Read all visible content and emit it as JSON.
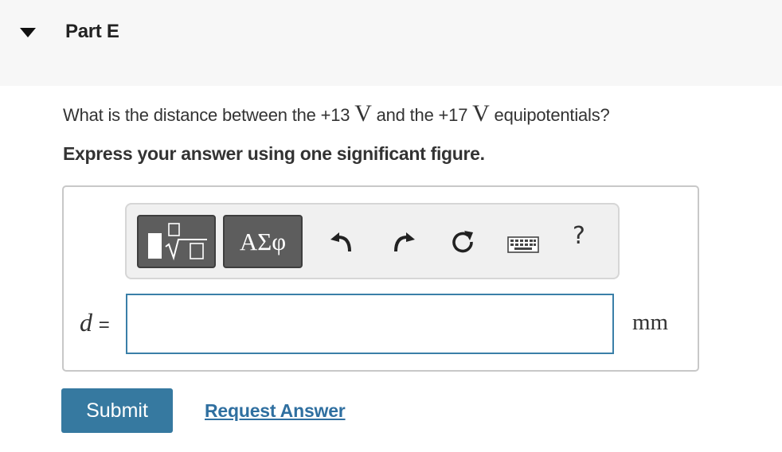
{
  "part": {
    "title": "Part E"
  },
  "question": {
    "prefix": "What is the distance between the +13 ",
    "unit_symbol_1": "V",
    "middle": " and the +17 ",
    "unit_symbol_2": "V",
    "suffix": " equipotentials?",
    "instruction": "Express your answer using one significant figure."
  },
  "toolbar": {
    "template_button_icon": "template-sqrt-icon",
    "symbols_button_label": "ΑΣφ",
    "undo_icon": "undo-icon",
    "redo_icon": "redo-icon",
    "reset_icon": "reset-icon",
    "keyboard_icon": "keyboard-icon",
    "help_label": "?"
  },
  "answer": {
    "variable": "d",
    "equals": "=",
    "value": "",
    "unit": "mm"
  },
  "actions": {
    "submit_label": "Submit",
    "request_answer_label": "Request Answer"
  },
  "colors": {
    "header_bg": "#f7f7f7",
    "submit_bg": "#3679a0",
    "link": "#2f6fa0",
    "input_border": "#3a7fa8",
    "toolbar_button": "#5d5d5d"
  }
}
